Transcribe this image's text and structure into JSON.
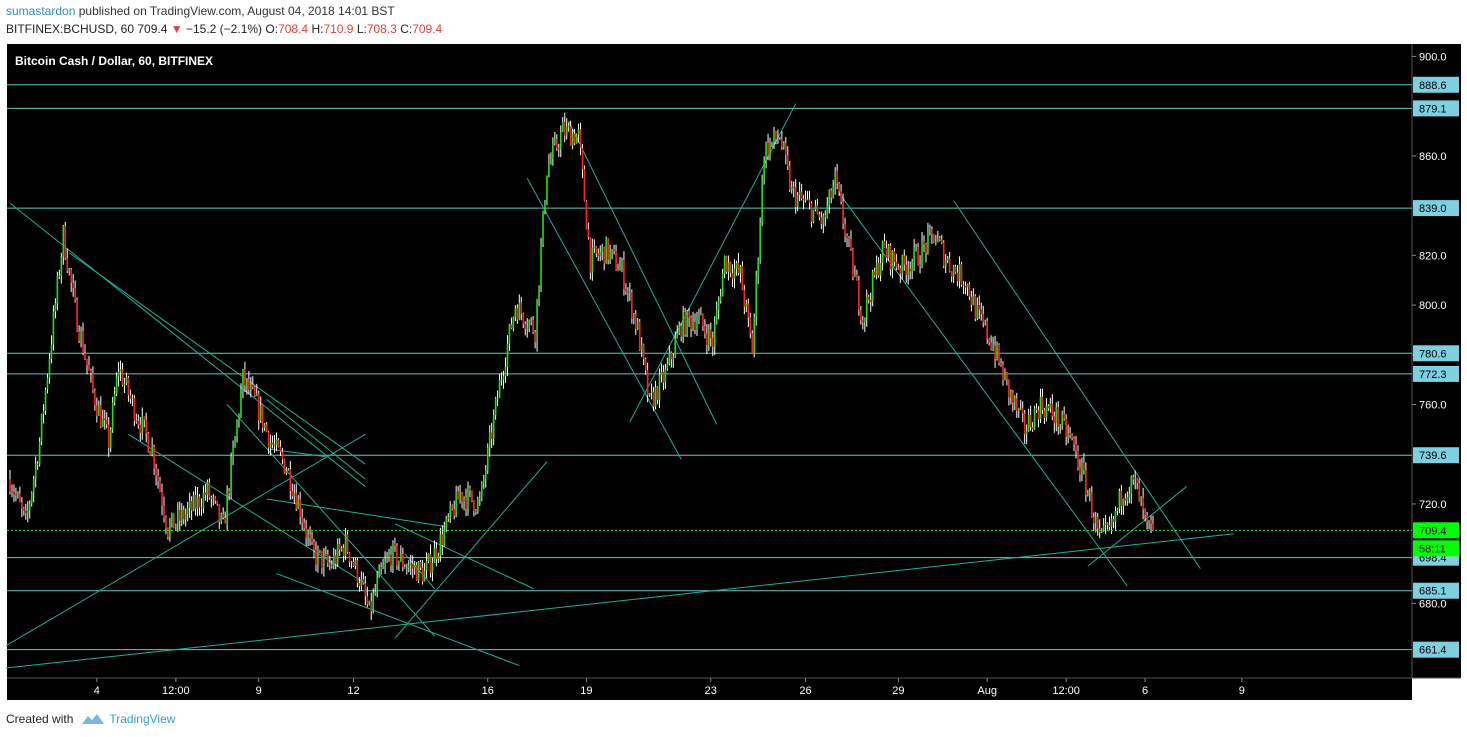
{
  "header": {
    "author": "sumastardon",
    "published_text": "published on TradingView.com, August 04, 2018 14:01 BST",
    "symbol": "BITFINEX:BCHUSD, 60",
    "last": "709.4",
    "down_arrow": "▼",
    "change": "−15.2 (−2.1%)",
    "o_label": "O:",
    "o_value": "708.4",
    "h_label": "H:",
    "h_value": "710.9",
    "l_label": "L:",
    "l_value": "708.3",
    "c_label": "C:",
    "c_value": "709.4"
  },
  "footer": {
    "created_with": "Created with",
    "brand": "TradingView"
  },
  "colors": {
    "background": "#000000",
    "up_candle": "#22dd22",
    "down_candle": "#ff2222",
    "wick": "#ffffff",
    "level_line": "#5fc9c2",
    "trend_line": "#1faf9a",
    "level_label_bg": "#7ecfe0",
    "current_price_bg": "#00ff00"
  },
  "chart_data": {
    "type": "candlestick",
    "title": "Bitcoin Cash / Dollar, 60, BITFINEX",
    "ylim": [
      650,
      905
    ],
    "y_ticks": [
      "900.0",
      "860.0",
      "820.0",
      "800.0",
      "780.0",
      "760.0",
      "720.0",
      "680.0"
    ],
    "x_ticks": [
      "4",
      "12:00",
      "9",
      "12",
      "16",
      "19",
      "23",
      "26",
      "29",
      "Aug",
      "12:00",
      "6",
      "9"
    ],
    "levels": [
      "888.6",
      "879.1",
      "839.0",
      "780.6",
      "772.3",
      "739.6",
      "698.4",
      "685.1",
      "661.4"
    ],
    "current_price": "709.4",
    "secondary_label": "58:11",
    "price_path": [
      {
        "i": 0,
        "p": 730
      },
      {
        "i": 8,
        "p": 712
      },
      {
        "i": 15,
        "p": 745
      },
      {
        "i": 20,
        "p": 780
      },
      {
        "i": 27,
        "p": 828
      },
      {
        "i": 33,
        "p": 798
      },
      {
        "i": 42,
        "p": 765
      },
      {
        "i": 50,
        "p": 745
      },
      {
        "i": 55,
        "p": 775
      },
      {
        "i": 62,
        "p": 760
      },
      {
        "i": 72,
        "p": 742
      },
      {
        "i": 80,
        "p": 710
      },
      {
        "i": 92,
        "p": 718
      },
      {
        "i": 100,
        "p": 725
      },
      {
        "i": 108,
        "p": 710
      },
      {
        "i": 118,
        "p": 770
      },
      {
        "i": 125,
        "p": 760
      },
      {
        "i": 132,
        "p": 745
      },
      {
        "i": 140,
        "p": 735
      },
      {
        "i": 147,
        "p": 718
      },
      {
        "i": 153,
        "p": 700
      },
      {
        "i": 162,
        "p": 695
      },
      {
        "i": 170,
        "p": 704
      },
      {
        "i": 177,
        "p": 690
      },
      {
        "i": 182,
        "p": 676
      },
      {
        "i": 187,
        "p": 690
      },
      {
        "i": 193,
        "p": 700
      },
      {
        "i": 200,
        "p": 696
      },
      {
        "i": 210,
        "p": 692
      },
      {
        "i": 218,
        "p": 705
      },
      {
        "i": 228,
        "p": 724
      },
      {
        "i": 238,
        "p": 720
      },
      {
        "i": 248,
        "p": 768
      },
      {
        "i": 256,
        "p": 800
      },
      {
        "i": 266,
        "p": 790
      },
      {
        "i": 272,
        "p": 855
      },
      {
        "i": 280,
        "p": 870
      },
      {
        "i": 288,
        "p": 868
      },
      {
        "i": 294,
        "p": 818
      },
      {
        "i": 302,
        "p": 822
      },
      {
        "i": 310,
        "p": 814
      },
      {
        "i": 318,
        "p": 790
      },
      {
        "i": 324,
        "p": 760
      },
      {
        "i": 332,
        "p": 772
      },
      {
        "i": 340,
        "p": 792
      },
      {
        "i": 348,
        "p": 795
      },
      {
        "i": 356,
        "p": 785
      },
      {
        "i": 362,
        "p": 818
      },
      {
        "i": 370,
        "p": 812
      },
      {
        "i": 376,
        "p": 782
      },
      {
        "i": 382,
        "p": 862
      },
      {
        "i": 390,
        "p": 868
      },
      {
        "i": 396,
        "p": 845
      },
      {
        "i": 404,
        "p": 840
      },
      {
        "i": 412,
        "p": 833
      },
      {
        "i": 418,
        "p": 850
      },
      {
        "i": 426,
        "p": 818
      },
      {
        "i": 432,
        "p": 795
      },
      {
        "i": 442,
        "p": 822
      },
      {
        "i": 452,
        "p": 815
      },
      {
        "i": 460,
        "p": 820
      },
      {
        "i": 468,
        "p": 828
      },
      {
        "i": 476,
        "p": 816
      },
      {
        "i": 484,
        "p": 810
      },
      {
        "i": 490,
        "p": 796
      },
      {
        "i": 498,
        "p": 784
      },
      {
        "i": 506,
        "p": 765
      },
      {
        "i": 514,
        "p": 750
      },
      {
        "i": 522,
        "p": 760
      },
      {
        "i": 530,
        "p": 755
      },
      {
        "i": 538,
        "p": 745
      },
      {
        "i": 546,
        "p": 725
      },
      {
        "i": 552,
        "p": 705
      },
      {
        "i": 558,
        "p": 710
      },
      {
        "i": 564,
        "p": 726
      },
      {
        "i": 570,
        "p": 728
      },
      {
        "i": 576,
        "p": 709.4
      }
    ],
    "trend_lines": [
      {
        "from": [
          0,
          841
        ],
        "to": [
          180,
          727
        ]
      },
      {
        "from": [
          30,
          821
        ],
        "to": [
          180,
          736
        ]
      },
      {
        "from": [
          -2,
          663
        ],
        "to": [
          180,
          748
        ]
      },
      {
        "from": [
          60,
          748
        ],
        "to": [
          180,
          688
        ]
      },
      {
        "from": [
          110,
          760
        ],
        "to": [
          215,
          667
        ]
      },
      {
        "from": [
          130,
          722
        ],
        "to": [
          220,
          711
        ]
      },
      {
        "from": [
          130,
          762
        ],
        "to": [
          180,
          730
        ]
      },
      {
        "from": [
          132,
          742
        ],
        "to": [
          160,
          739
        ]
      },
      {
        "from": [
          135,
          692
        ],
        "to": [
          258,
          655
        ]
      },
      {
        "from": [
          195,
          712
        ],
        "to": [
          265,
          686
        ]
      },
      {
        "from": [
          200,
          700
        ],
        "to": [
          215,
          686
        ]
      },
      {
        "from": [
          195,
          666
        ],
        "to": [
          272,
          737
        ]
      },
      {
        "from": [
          -2,
          654
        ],
        "to": [
          620,
          708
        ]
      },
      {
        "from": [
          262,
          851
        ],
        "to": [
          340,
          738
        ]
      },
      {
        "from": [
          283,
          874
        ],
        "to": [
          358,
          752
        ]
      },
      {
        "from": [
          314,
          753
        ],
        "to": [
          398,
          881
        ]
      },
      {
        "from": [
          300,
          820
        ],
        "to": [
          300,
          820
        ]
      },
      {
        "from": [
          420,
          845
        ],
        "to": [
          566,
          687
        ]
      },
      {
        "from": [
          478,
          842
        ],
        "to": [
          603,
          694
        ]
      },
      {
        "from": [
          546,
          695
        ],
        "to": [
          596,
          727
        ]
      }
    ]
  }
}
